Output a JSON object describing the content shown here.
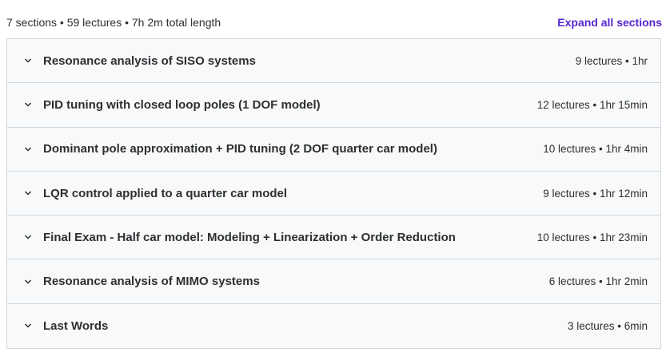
{
  "curriculum": {
    "summary": "7 sections • 59 lectures • 7h 2m total length",
    "expand_all_label": "Expand all sections",
    "accent_color": "#5624d0",
    "sections": [
      {
        "title": "Resonance analysis of SISO systems",
        "meta": "9 lectures • 1hr",
        "icon": "chevron-down-icon"
      },
      {
        "title": "PID tuning with closed loop poles (1 DOF model)",
        "meta": "12 lectures • 1hr 15min",
        "icon": "chevron-down-icon"
      },
      {
        "title": "Dominant pole approximation + PID tuning (2 DOF quarter car model)",
        "meta": "10 lectures • 1hr 4min",
        "icon": "chevron-down-icon"
      },
      {
        "title": "LQR control applied to a quarter car model",
        "meta": "9 lectures • 1hr 12min",
        "icon": "chevron-down-icon"
      },
      {
        "title": "Final Exam - Half car model: Modeling + Linearization + Order Reduction",
        "meta": "10 lectures • 1hr 23min",
        "icon": "chevron-down-icon"
      },
      {
        "title": "Resonance analysis of MIMO systems",
        "meta": "6 lectures • 1hr 2min",
        "icon": "chevron-down-icon"
      },
      {
        "title": "Last Words",
        "meta": "3 lectures • 6min",
        "icon": "chevron-down-icon"
      }
    ]
  }
}
